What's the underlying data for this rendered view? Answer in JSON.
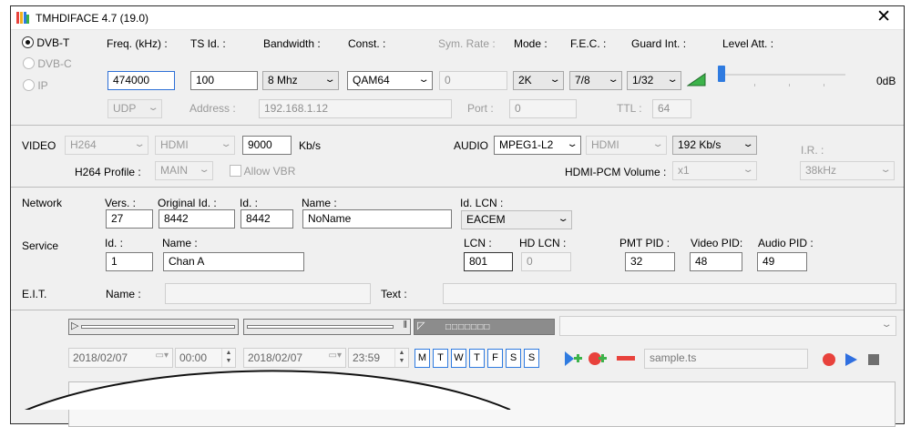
{
  "window": {
    "title": "TMHDIFACE 4.7 (19.0)"
  },
  "modes": [
    {
      "label": "DVB-T",
      "selected": true
    },
    {
      "label": "DVB-C",
      "selected": false
    },
    {
      "label": "IP",
      "selected": false
    }
  ],
  "tuner": {
    "freq_label": "Freq. (kHz) :",
    "freq_value": "474000",
    "tsid_label": "TS Id. :",
    "tsid_value": "100",
    "bandwidth_label": "Bandwidth :",
    "bandwidth_value": "8 Mhz",
    "const_label": "Const. :",
    "const_value": "QAM64",
    "symrate_label": "Sym. Rate :",
    "symrate_value": "0",
    "mode_label": "Mode :",
    "mode_value": "2K",
    "fec_label": "F.E.C. :",
    "fec_value": "7/8",
    "guard_label": "Guard Int. :",
    "guard_value": "1/32",
    "level_label": "Level Att. :",
    "level_value": "0dB",
    "level_fraction": 0.0
  },
  "ip": {
    "protocol": "UDP",
    "address_label": "Address :",
    "address_value": "192.168.1.12",
    "port_label": "Port :",
    "port_value": "0",
    "ttl_label": "TTL :",
    "ttl_value": "64"
  },
  "video": {
    "label": "VIDEO",
    "codec": "H264",
    "input": "HDMI",
    "bitrate": "9000",
    "unit": "Kb/s",
    "profile_label": "H264 Profile :",
    "profile_value": "MAIN",
    "vbr_label": "Allow VBR"
  },
  "audio": {
    "label": "AUDIO",
    "codec": "MPEG1-L2",
    "input": "HDMI",
    "bitrate": "192 Kb/s",
    "ir_label": "I.R. :",
    "ir_value": "38kHz",
    "pcm_label": "HDMI-PCM Volume :",
    "pcm_value": "x1"
  },
  "network": {
    "label": "Network",
    "vers_label": "Vers. :",
    "vers_value": "27",
    "orig_label": "Original Id. :",
    "orig_value": "8442",
    "id_label": "Id. :",
    "id_value": "8442",
    "name_label": "Name :",
    "name_value": "NoName",
    "lcn_label": "Id. LCN :",
    "lcn_value": "EACEM"
  },
  "service": {
    "label": "Service",
    "id_label": "Id. :",
    "id_value": "1",
    "name_label": "Name :",
    "name_value": "Chan A",
    "lcn_label": "LCN :",
    "lcn_value": "801",
    "hdlcn_label": "HD LCN :",
    "hdlcn_value": "0",
    "pmt_label": "PMT PID :",
    "pmt_value": "32",
    "video_label": "Video PID:",
    "video_value": "48",
    "audio_label": "Audio PID :",
    "audio_value": "49"
  },
  "eit": {
    "label": "E.I.T.",
    "name_label": "Name :",
    "name_value": "",
    "text_label": "Text :",
    "text_value": ""
  },
  "schedule": {
    "start_date": "2018/02/07",
    "start_time": "00:00",
    "end_date": "2018/02/07",
    "end_time": "23:59",
    "days": [
      "M",
      "T",
      "W",
      "T",
      "F",
      "S",
      "S"
    ],
    "file": "sample.ts"
  },
  "colors": {
    "accent": "#2f7be0",
    "record": "#e8423c",
    "add": "#3cb34a",
    "remove": "#e8423c",
    "play": "#2f6fe0"
  }
}
